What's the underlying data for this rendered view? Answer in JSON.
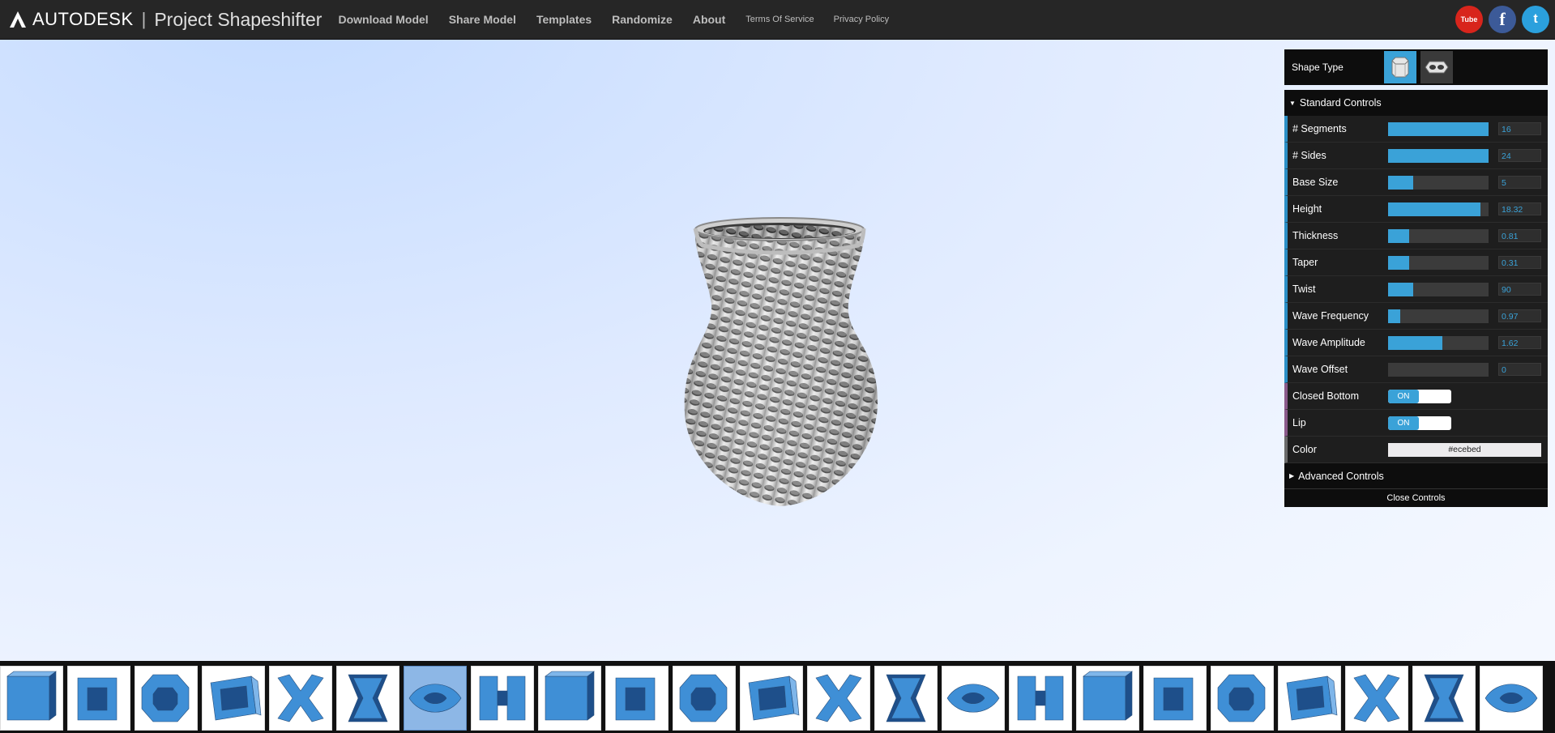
{
  "header": {
    "brand": "AUTODESK",
    "separator": "|",
    "product": "Project Shapeshifter",
    "nav": [
      {
        "label": "Download Model",
        "name": "nav-download-model"
      },
      {
        "label": "Share Model",
        "name": "nav-share-model"
      },
      {
        "label": "Templates",
        "name": "nav-templates"
      },
      {
        "label": "Randomize",
        "name": "nav-randomize"
      },
      {
        "label": "About",
        "name": "nav-about"
      },
      {
        "label": "Terms Of Service",
        "name": "nav-terms-of-service"
      },
      {
        "label": "Privacy Policy",
        "name": "nav-privacy-policy"
      }
    ],
    "social": {
      "youtube": "Tube",
      "facebook": "f",
      "twitter": "t"
    }
  },
  "panel": {
    "shape_type_label": "Shape Type",
    "standard_controls_label": "Standard Controls",
    "advanced_controls_label": "Advanced Controls",
    "close_controls_label": "Close Controls",
    "controls": [
      {
        "label": "# Segments",
        "value": "16",
        "level": 1.0
      },
      {
        "label": "# Sides",
        "value": "24",
        "level": 1.0
      },
      {
        "label": "Base Size",
        "value": "5",
        "level": 0.25
      },
      {
        "label": "Height",
        "value": "18.32",
        "level": 0.92
      },
      {
        "label": "Thickness",
        "value": "0.81",
        "level": 0.21
      },
      {
        "label": "Taper",
        "value": "0.31",
        "level": 0.21
      },
      {
        "label": "Twist",
        "value": "90",
        "level": 0.25
      },
      {
        "label": "Wave Frequency",
        "value": "0.97",
        "level": 0.12
      },
      {
        "label": "Wave Amplitude",
        "value": "1.62",
        "level": 0.54
      },
      {
        "label": "Wave Offset",
        "value": "0",
        "level": 0.0
      }
    ],
    "toggles": [
      {
        "label": "Closed Bottom",
        "state": "ON"
      },
      {
        "label": "Lip",
        "state": "ON"
      }
    ],
    "color": {
      "label": "Color",
      "value": "#ecebed"
    }
  },
  "colors": {
    "accent": "#3aa2d8",
    "topbar": "#262626",
    "panel": "#0d0d0d"
  },
  "thumbnails": [
    "solid-cube-icon",
    "square-frame-icon",
    "octagon-ring-icon",
    "rounded-ring-icon",
    "x-shape-icon",
    "pinched-x-icon",
    "eye-shape-icon",
    "twin-pillars-icon",
    "folded-pyramid-icon",
    "curved-ramp-icon",
    "cylinder-drum-icon",
    "cylinder-icon",
    "twisted-block-icon",
    "step-block-icon",
    "t-block-icon",
    "star-cutout-icon",
    "rotated-frame-icon",
    "tilted-frame-icon",
    "wedge-box-icon",
    "star-box-icon",
    "heart-box-icon",
    "stair-block-icon",
    "x-frame-icon"
  ],
  "selected_thumbnail": 6
}
